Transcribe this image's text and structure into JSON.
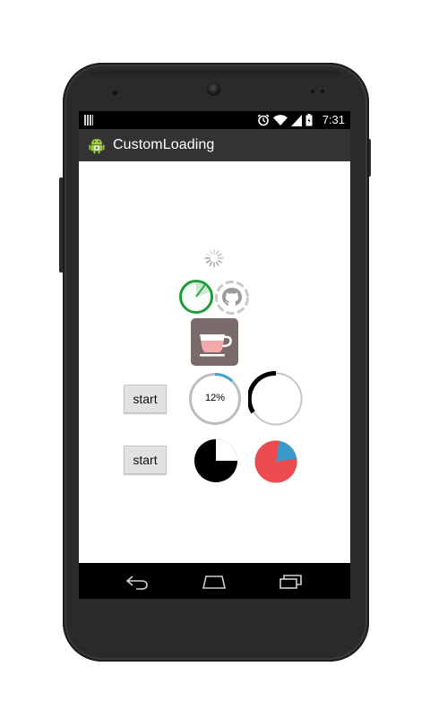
{
  "status_bar": {
    "time": "7:31",
    "icons": [
      "alarm-icon",
      "wifi-icon",
      "signal-icon",
      "battery-icon"
    ]
  },
  "action_bar": {
    "title": "CustomLoading",
    "icon": "android-app-icon",
    "background": "#333333"
  },
  "loaders": {
    "spinner": "spinner-icon",
    "circle_green": {
      "color": "#1f9d3a",
      "icon": "green-circle-progress"
    },
    "github_loader": {
      "icon": "github-octocat-icon"
    },
    "cup_loader": {
      "icon": "coffee-cup-icon",
      "fill_color": "#f3a9a9",
      "bg_color": "#7a6a6a"
    }
  },
  "row1": {
    "start_label": "start",
    "percent_text": "12%",
    "percent_value": 12,
    "ring_color": "#3fa3d9",
    "arc_ring_color": "#000000"
  },
  "row2": {
    "start_label": "start",
    "pie_black_fraction": 0.75,
    "pie_red_fraction": 0.8,
    "pie_red_color": "#ee4b51",
    "pie_blue_color": "#3b99c8"
  },
  "nav_bar": {
    "back": "back-icon",
    "home": "home-icon",
    "recents": "recents-icon"
  }
}
